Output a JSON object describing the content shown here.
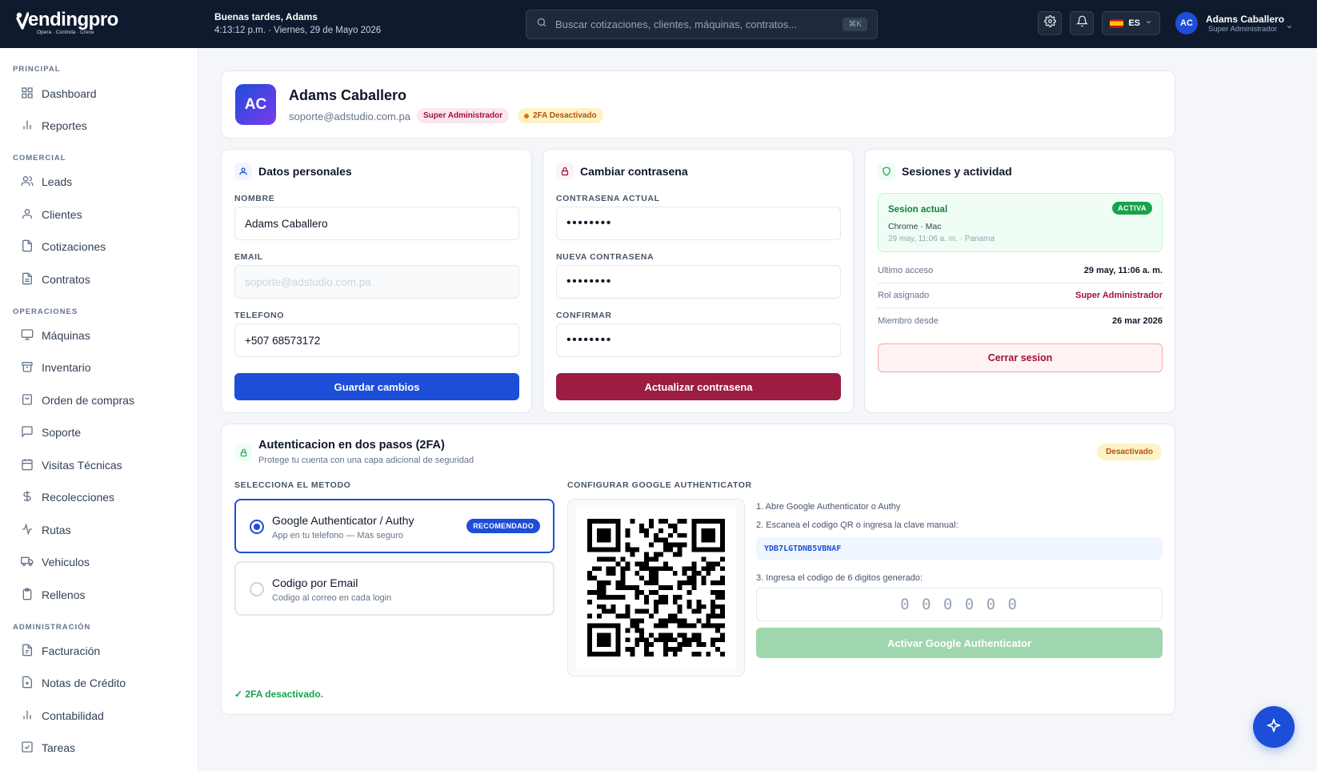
{
  "brand": {
    "name": "endingpro",
    "tagline": "Opera · Controla · Crece"
  },
  "header": {
    "greeting": "Buenas tardes, Adams",
    "datetime": "4:13:12 p.m. · Viernes, 29 de Mayo 2026",
    "search_placeholder": "Buscar cotizaciones, clientes, máquinas, contratos...",
    "search_shortcut": "⌘K",
    "lang": "ES",
    "user_initials": "AC",
    "user_name": "Adams Caballero",
    "user_role": "Super Administrador"
  },
  "sidebar": {
    "sections": [
      {
        "title": "PRINCIPAL",
        "items": [
          {
            "label": "Dashboard",
            "icon": "grid-icon"
          },
          {
            "label": "Reportes",
            "icon": "bar-chart-icon"
          }
        ]
      },
      {
        "title": "COMERCIAL",
        "items": [
          {
            "label": "Leads",
            "icon": "users-icon"
          },
          {
            "label": "Clientes",
            "icon": "user-icon"
          },
          {
            "label": "Cotizaciones",
            "icon": "file-icon"
          },
          {
            "label": "Contratos",
            "icon": "file-text-icon"
          }
        ]
      },
      {
        "title": "OPERACIONES",
        "items": [
          {
            "label": "Máquinas",
            "icon": "monitor-icon"
          },
          {
            "label": "Inventario",
            "icon": "box-icon"
          },
          {
            "label": "Orden de compras",
            "icon": "cart-icon"
          },
          {
            "label": "Soporte",
            "icon": "chat-icon"
          },
          {
            "label": "Visitas Técnicas",
            "icon": "calendar-icon"
          },
          {
            "label": "Recolecciones",
            "icon": "dollar-icon"
          },
          {
            "label": "Rutas",
            "icon": "route-icon"
          },
          {
            "label": "Vehiculos",
            "icon": "truck-icon"
          },
          {
            "label": "Rellenos",
            "icon": "clipboard-icon"
          }
        ]
      },
      {
        "title": "ADMINISTRACIÓN",
        "items": [
          {
            "label": "Facturación",
            "icon": "invoice-icon"
          },
          {
            "label": "Notas de Crédito",
            "icon": "credit-note-icon"
          },
          {
            "label": "Contabilidad",
            "icon": "chart-icon"
          },
          {
            "label": "Tareas",
            "icon": "check-square-icon"
          }
        ]
      }
    ]
  },
  "profile": {
    "initials": "AC",
    "name": "Adams Caballero",
    "email": "soporte@adstudio.com.pa",
    "role_badge": "Super Administrador",
    "twofa_badge": "2FA Desactivado"
  },
  "personal": {
    "title": "Datos personales",
    "name_label": "NOMBRE",
    "name_value": "Adams Caballero",
    "email_label": "EMAIL",
    "email_value": "soporte@adstudio.com.pa",
    "phone_label": "TELEFONO",
    "phone_value": "+507 68573172",
    "save_button": "Guardar cambios"
  },
  "password": {
    "title": "Cambiar contrasena",
    "current_label": "CONTRASENA ACTUAL",
    "new_label": "NUEVA CONTRASENA",
    "confirm_label": "CONFIRMAR",
    "mask": "••••••••",
    "update_button": "Actualizar contrasena"
  },
  "sessions": {
    "title": "Sesiones y actividad",
    "current_title": "Sesion actual",
    "active_badge": "ACTIVA",
    "device": "Chrome · Mac",
    "session_detail": "29 may, 11:06 a. m. · Panama",
    "rows": [
      {
        "key": "Ultimo acceso",
        "value": "29 may, 11:06 a. m."
      },
      {
        "key": "Rol asignado",
        "value": "Super Administrador"
      },
      {
        "key": "Miembro desde",
        "value": "26 mar 2026"
      }
    ],
    "logout_button": "Cerrar sesion"
  },
  "twofa": {
    "title": "Autenticacion en dos pasos (2FA)",
    "subtitle": "Protege tu cuenta con una capa adicional de seguridad",
    "status_badge": "Desactivado",
    "method_label": "SELECCIONA EL METODO",
    "options": [
      {
        "title": "Google Authenticator / Authy",
        "subtitle": "App en tu telefono — Mas seguro",
        "badge": "RECOMENDADO",
        "selected": true
      },
      {
        "title": "Codigo por Email",
        "subtitle": "Codigo al correo en cada login",
        "selected": false
      }
    ],
    "config_label": "CONFIGURAR GOOGLE AUTHENTICATOR",
    "step1": "1. Abre Google Authenticator o Authy",
    "step2": "2. Escanea el codigo QR o ingresa la clave manual:",
    "secret_key": "YDB7LGTDNB5VBNAF",
    "step3": "3. Ingresa el codigo de 6 digitos generado:",
    "code_placeholder": "0 0 0 0 0 0",
    "activate_button": "Activar Google Authenticator",
    "status_message": "✓ 2FA desactivado."
  },
  "colors": {
    "topbar": "#0f1a2e",
    "primary": "#1d4ed8",
    "maroon": "#9f1239",
    "success": "#16a34a",
    "warning": "#d97706"
  }
}
